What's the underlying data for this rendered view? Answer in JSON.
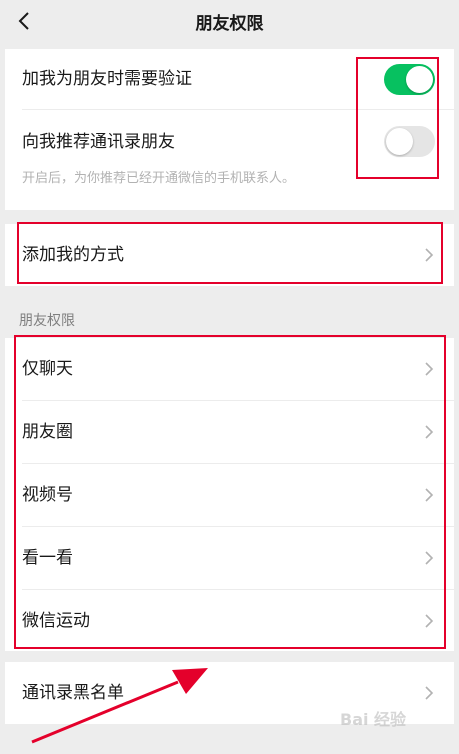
{
  "nav": {
    "title": "朋友权限",
    "back_icon": "chevron-left-icon"
  },
  "verification": {
    "add_verify_label": "加我为朋友时需要验证",
    "add_verify_on": true,
    "recommend_label": "向我推荐通讯录朋友",
    "recommend_on": false,
    "recommend_hint": "开启后，为你推荐已经开通微信的手机联系人。"
  },
  "add_methods": {
    "label": "添加我的方式"
  },
  "friend_permissions": {
    "header": "朋友权限",
    "items": [
      {
        "label": "仅聊天"
      },
      {
        "label": "朋友圈"
      },
      {
        "label": "视频号"
      },
      {
        "label": "看一看"
      },
      {
        "label": "微信运动"
      }
    ]
  },
  "blacklist": {
    "label": "通讯录黑名单"
  },
  "watermark": "Bai 经验",
  "colors": {
    "toggle_on": "#07c160",
    "toggle_off": "#e5e5e5",
    "highlight": "#e4002b",
    "background": "#ededed"
  }
}
